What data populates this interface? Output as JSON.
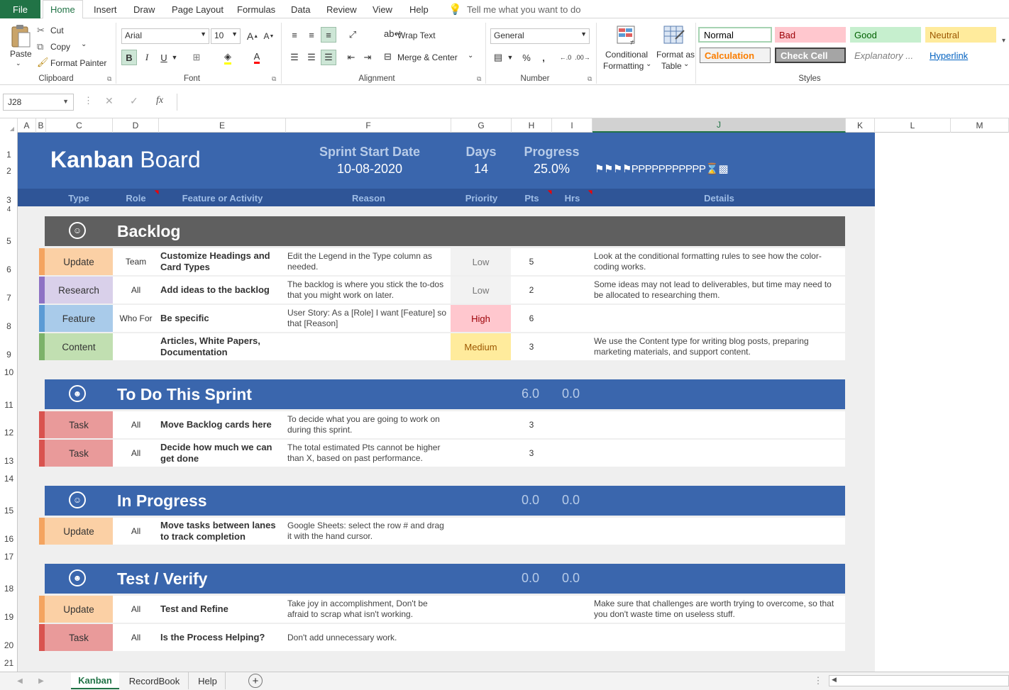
{
  "menu": {
    "file": "File",
    "tabs": [
      "Home",
      "Insert",
      "Draw",
      "Page Layout",
      "Formulas",
      "Data",
      "Review",
      "View",
      "Help"
    ],
    "tell": "Tell me what you want to do"
  },
  "ribbon": {
    "clipboard": {
      "paste": "Paste",
      "cut": "Cut",
      "copy": "Copy",
      "format_painter": "Format Painter",
      "label": "Clipboard"
    },
    "font": {
      "name": "Arial",
      "size": "10",
      "bold": "B",
      "italic": "I",
      "underline": "U",
      "label": "Font"
    },
    "alignment": {
      "wrap": "Wrap Text",
      "merge": "Merge & Center",
      "label": "Alignment"
    },
    "number": {
      "format": "General",
      "percent": "%",
      "comma": ",",
      "label": "Number"
    },
    "cond_format": {
      "line1": "Conditional",
      "line2": "Formatting"
    },
    "format_table": {
      "line1": "Format as",
      "line2": "Table"
    },
    "styles": {
      "label": "Styles",
      "items": [
        {
          "name": "Normal",
          "bg": "#ffffff",
          "color": "#000000"
        },
        {
          "name": "Bad",
          "bg": "#ffc7ce",
          "color": "#9c0006"
        },
        {
          "name": "Good",
          "bg": "#c6efce",
          "color": "#006100"
        },
        {
          "name": "Neutral",
          "bg": "#ffeb9c",
          "color": "#9c5700"
        },
        {
          "name": "Calculation",
          "bg": "#f2f2f2",
          "color": "#fa7d00"
        },
        {
          "name": "Check Cell",
          "bg": "#a5a5a5",
          "color": "#ffffff"
        },
        {
          "name": "Explanatory ...",
          "bg": "#ffffff",
          "color": "#7f7f7f"
        },
        {
          "name": "Hyperlink",
          "bg": "#ffffff",
          "color": "#0563c1"
        }
      ]
    }
  },
  "formula": {
    "name_box": "J28",
    "fx": "fx",
    "value": ""
  },
  "columns": [
    "A",
    "B",
    "C",
    "D",
    "E",
    "F",
    "G",
    "H",
    "I",
    "J",
    "K",
    "L",
    "M"
  ],
  "rows": [
    "1",
    "2",
    "3",
    "4",
    "5",
    "6",
    "7",
    "8",
    "9",
    "10",
    "11",
    "12",
    "13",
    "14",
    "15",
    "16",
    "17",
    "18",
    "19",
    "20",
    "21"
  ],
  "board": {
    "title_bold": "Kanban",
    "title_rest": "Board",
    "sprint_label": "Sprint Start Date",
    "sprint_value": "10-08-2020",
    "days_label": "Days",
    "days_value": "14",
    "progress_label": "Progress",
    "progress_value": "25.0%",
    "progress_glyphs": "⚑⚑⚑⚑PPPPPPPPPPP⌛▩",
    "headers": {
      "type": "Type",
      "role": "Role",
      "feature": "Feature or Activity",
      "reason": "Reason",
      "priority": "Priority",
      "pts": "Pts",
      "hrs": "Hrs",
      "details": "Details"
    }
  },
  "sections": [
    {
      "title": "Backlog",
      "pts": "",
      "hrs": "",
      "bg": "#5f5f5f",
      "cards": [
        {
          "type": "Update",
          "role": "Team",
          "feature": "Customize Headings and Card Types",
          "reason": "Edit the Legend in the Type column as needed.",
          "priority": "Low",
          "pts": "5",
          "details": "Look at the conditional formatting rules to see how the color-coding works.",
          "strip": "#f4a460",
          "type_bg": "#fbd0a5",
          "prio_bg": "#f2f2f2",
          "prio_color": "#777777"
        },
        {
          "type": "Research",
          "role": "All",
          "feature": "Add ideas to the backlog",
          "reason": "The backlog is where you stick the to-dos that you might work on later.",
          "priority": "Low",
          "pts": "2",
          "details": "Some ideas may not lead to deliverables, but time may need to be allocated to researching them.",
          "strip": "#8e72c4",
          "type_bg": "#d9d0ea",
          "prio_bg": "#f2f2f2",
          "prio_color": "#777777"
        },
        {
          "type": "Feature",
          "role": "Who For",
          "feature": "Be specific",
          "reason": "User Story: As a [Role] I want [Feature] so that [Reason]",
          "priority": "High",
          "pts": "6",
          "details": "",
          "strip": "#5b9bd5",
          "type_bg": "#a9cbea",
          "prio_bg": "#ffc7ce",
          "prio_color": "#9c0006"
        },
        {
          "type": "Content",
          "role": "",
          "feature": "Articles, White Papers, Documentation",
          "reason": "",
          "priority": "Medium",
          "pts": "3",
          "details": "We use the Content type for writing blog posts, preparing marketing materials, and support content.",
          "strip": "#7cb26a",
          "type_bg": "#c1dfb1",
          "prio_bg": "#ffeb9c",
          "prio_color": "#9c5700"
        }
      ]
    },
    {
      "title": "To Do This Sprint",
      "pts": "6.0",
      "hrs": "0.0",
      "bg": "#3a66ad",
      "cards": [
        {
          "type": "Task",
          "role": "All",
          "feature": "Move Backlog cards here",
          "reason": "To decide what you are going to work on during this sprint.",
          "priority": "",
          "pts": "3",
          "details": "",
          "strip": "#d9534f",
          "type_bg": "#e99a9a",
          "prio_bg": "#ffffff",
          "prio_color": "#333333"
        },
        {
          "type": "Task",
          "role": "All",
          "feature": "Decide how much we can get done",
          "reason": "The total estimated Pts cannot be higher than X, based on past performance.",
          "priority": "",
          "pts": "3",
          "details": "",
          "strip": "#d9534f",
          "type_bg": "#e99a9a",
          "prio_bg": "#ffffff",
          "prio_color": "#333333"
        }
      ]
    },
    {
      "title": "In Progress",
      "pts": "0.0",
      "hrs": "0.0",
      "bg": "#3a66ad",
      "cards": [
        {
          "type": "Update",
          "role": "All",
          "feature": "Move tasks between lanes to track completion",
          "reason": "Google Sheets: select the row # and drag it with the hand cursor.",
          "priority": "",
          "pts": "",
          "details": "",
          "strip": "#f4a460",
          "type_bg": "#fbd0a5",
          "prio_bg": "#ffffff",
          "prio_color": "#333333"
        }
      ]
    },
    {
      "title": "Test / Verify",
      "pts": "0.0",
      "hrs": "0.0",
      "bg": "#3a66ad",
      "cards": [
        {
          "type": "Update",
          "role": "All",
          "feature": "Test and Refine",
          "reason": "Take joy in accomplishment, Don't be afraid to scrap what isn't working.",
          "priority": "",
          "pts": "",
          "details": "Make sure that challenges are worth trying to overcome, so that you don't waste time on useless stuff.",
          "strip": "#f4a460",
          "type_bg": "#fbd0a5",
          "prio_bg": "#ffffff",
          "prio_color": "#333333"
        },
        {
          "type": "Task",
          "role": "All",
          "feature": "Is the Process Helping?",
          "reason": "Don't add unnecessary work.",
          "priority": "",
          "pts": "",
          "details": "",
          "strip": "#d9534f",
          "type_bg": "#e99a9a",
          "prio_bg": "#ffffff",
          "prio_color": "#333333"
        }
      ]
    }
  ],
  "sheet_tabs": [
    "Kanban",
    "RecordBook",
    "Help"
  ],
  "add_sheet": "+"
}
